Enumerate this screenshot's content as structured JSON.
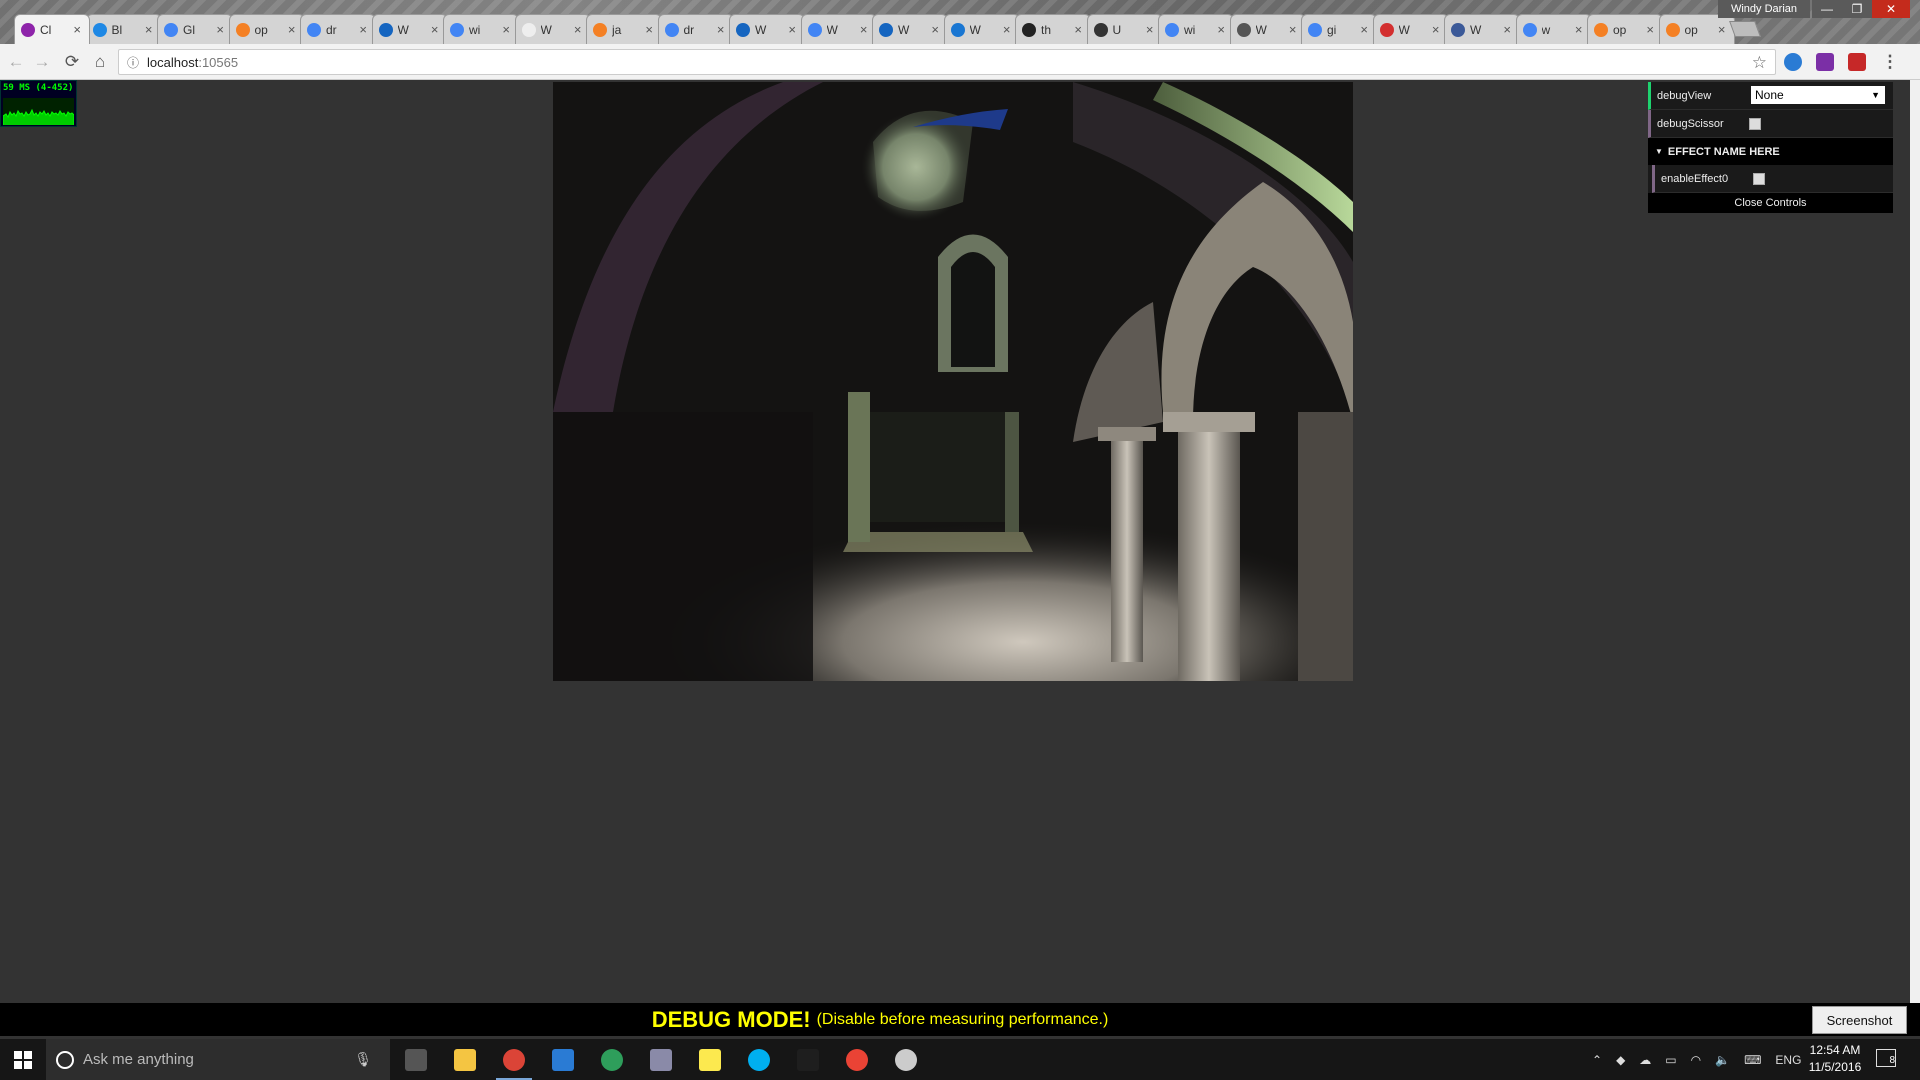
{
  "window": {
    "user_name": "Windy Darian",
    "minimize": "—",
    "maximize": "❐",
    "close": "✕"
  },
  "tabs": [
    {
      "label": "Cl",
      "active": true,
      "favicon_color": "#8e24aa"
    },
    {
      "label": "Bl",
      "favicon_color": "#1e88e5"
    },
    {
      "label": "Gl",
      "favicon_color": "#4285f4"
    },
    {
      "label": "op",
      "favicon_color": "#f48024"
    },
    {
      "label": "dr",
      "favicon_color": "#4285f4"
    },
    {
      "label": "W",
      "favicon_color": "#1565c0"
    },
    {
      "label": "wi",
      "favicon_color": "#4285f4"
    },
    {
      "label": "W",
      "favicon_color": "#eeeeee"
    },
    {
      "label": "ja",
      "favicon_color": "#f48024"
    },
    {
      "label": "dr",
      "favicon_color": "#4285f4"
    },
    {
      "label": "W",
      "favicon_color": "#1565c0"
    },
    {
      "label": "W",
      "favicon_color": "#4285f4"
    },
    {
      "label": "W",
      "favicon_color": "#1565c0"
    },
    {
      "label": "W",
      "favicon_color": "#1976d2"
    },
    {
      "label": "th",
      "favicon_color": "#222222"
    },
    {
      "label": "U",
      "favicon_color": "#333333"
    },
    {
      "label": "wi",
      "favicon_color": "#4285f4"
    },
    {
      "label": "W",
      "favicon_color": "#555555"
    },
    {
      "label": "gi",
      "favicon_color": "#4285f4"
    },
    {
      "label": "W",
      "favicon_color": "#d32f2f"
    },
    {
      "label": "W",
      "favicon_color": "#3b5998"
    },
    {
      "label": "w",
      "favicon_color": "#4285f4"
    },
    {
      "label": "op",
      "favicon_color": "#f48024"
    },
    {
      "label": "op",
      "favicon_color": "#f48024"
    }
  ],
  "toolbar": {
    "back": "←",
    "forward": "→",
    "reload": "⟳",
    "home": "⌂",
    "info_icon": "ⓘ",
    "url_host": "localhost",
    "url_port": ":10565",
    "star": "☆",
    "menu": "⋮"
  },
  "stats": {
    "text": "59 MS (4-452)"
  },
  "controls": {
    "debugView_label": "debugView",
    "debugView_value": "None",
    "debugScissor_label": "debugScissor",
    "debugScissor_checked": false,
    "folder_label": "EFFECT NAME HERE",
    "enableEffect0_label": "enableEffect0",
    "enableEffect0_checked": false,
    "close_label": "Close Controls"
  },
  "banner": {
    "title": "DEBUG MODE!",
    "subtitle": "(Disable before measuring performance.)"
  },
  "screenshot_button": "Screenshot",
  "taskbar": {
    "search_placeholder": "Ask me anything",
    "language": "ENG",
    "time": "12:54 AM",
    "date": "11/5/2016",
    "notification_count": "8",
    "apps": [
      {
        "name": "task-view",
        "color": "#555555"
      },
      {
        "name": "file-explorer",
        "color": "#f4c542"
      },
      {
        "name": "chrome",
        "color": "#db4437"
      },
      {
        "name": "visual-studio-code",
        "color": "#2a7bd4"
      },
      {
        "name": "sourcetree",
        "color": "#2e9e5b"
      },
      {
        "name": "paint-app",
        "color": "#8a8aa8"
      },
      {
        "name": "sticky-notes",
        "color": "#fce94f"
      },
      {
        "name": "skype",
        "color": "#00aff0"
      },
      {
        "name": "terminal",
        "color": "#1e1e1e"
      },
      {
        "name": "chrome-canary",
        "color": "#ea4335"
      },
      {
        "name": "obs",
        "color": "#cccccc"
      }
    ]
  }
}
